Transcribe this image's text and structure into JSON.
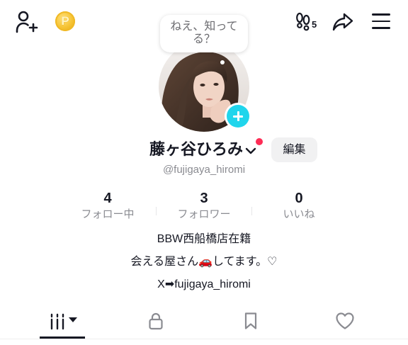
{
  "header": {
    "add_user_icon": "person-add-icon",
    "coin_icon": {
      "icon": "coin-icon",
      "glyph": "P"
    },
    "footprint": {
      "icon": "footprints-icon",
      "count": "5"
    },
    "share_icon": "share-icon",
    "menu_icon": "hamburger-menu-icon"
  },
  "profile": {
    "note_bubble": {
      "lines": [
        "ねえ、知って",
        "る？"
      ]
    },
    "avatar_icon": "profile-photo",
    "add_story_icon": "plus-icon",
    "name": "藤ヶ谷ひろみ",
    "name_chevron_icon": "chevron-down-icon",
    "edit_label": "編集",
    "username": "@fujigaya_hiromi"
  },
  "stats": [
    {
      "value": "4",
      "label": "フォロー中"
    },
    {
      "value": "3",
      "label": "フォロワー"
    },
    {
      "value": "0",
      "label": "いいね"
    }
  ],
  "bio": [
    "BBW西船橋店在籍",
    "会える屋さん🚗してます。♡",
    "X➡fujigaya_hiromi"
  ],
  "tabs": [
    {
      "icon": "videos-icon",
      "dropdown_icon": "caret-down-icon",
      "active": true
    },
    {
      "icon": "lock-icon",
      "active": false
    },
    {
      "icon": "bookmark-icon",
      "active": false
    },
    {
      "icon": "heart-icon",
      "active": false
    }
  ],
  "colors": {
    "accent": "#20d5ec",
    "red": "#fe2c55",
    "gray": "#8a8b91",
    "text": "#161823",
    "button_bg": "#f1f1f2",
    "coin": "#f5c231"
  }
}
